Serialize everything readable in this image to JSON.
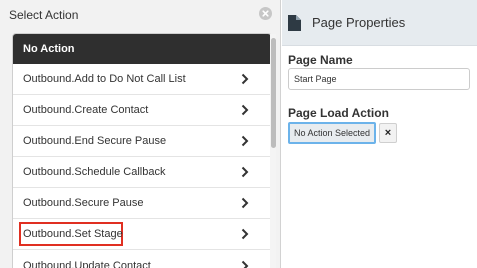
{
  "modal": {
    "title": "Select Action",
    "close_icon": "close-circle-icon"
  },
  "actions": [
    {
      "label": "No Action",
      "selected": true
    },
    {
      "label": "Outbound.Add to Do Not Call List"
    },
    {
      "label": "Outbound.Create Contact"
    },
    {
      "label": "Outbound.End Secure Pause"
    },
    {
      "label": "Outbound.Schedule Callback"
    },
    {
      "label": "Outbound.Secure Pause"
    },
    {
      "label": "Outbound.Set Stage",
      "highlighted": true
    },
    {
      "label": "Outbound.Update Contact"
    }
  ],
  "panel": {
    "title": "Page Properties",
    "icon": "document-icon",
    "page_name_label": "Page Name",
    "page_name_value": "Start Page",
    "page_load_action_label": "Page Load Action",
    "page_load_action_value": "No Action Selected",
    "clear_label": "×"
  },
  "colors": {
    "selected_row_bg": "#2f2f2f",
    "highlight_border": "#e02f21",
    "focus_border": "#6cb3ea",
    "panel_header_bg": "#e6ebef"
  }
}
